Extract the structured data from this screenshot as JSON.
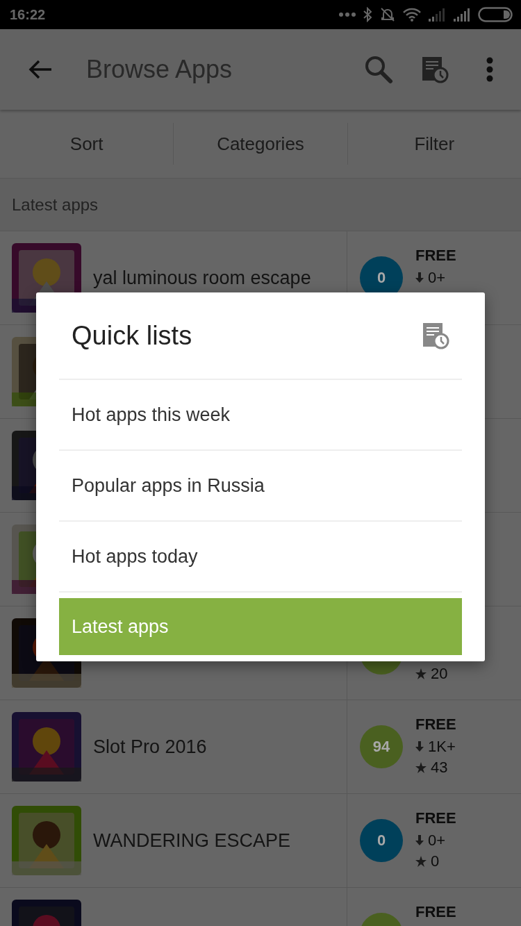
{
  "status_bar": {
    "time": "16:22"
  },
  "app_bar": {
    "title": "Browse Apps"
  },
  "tabs": [
    {
      "label": "Sort"
    },
    {
      "label": "Categories"
    },
    {
      "label": "Filter"
    }
  ],
  "section": {
    "title": "Latest apps"
  },
  "apps": [
    {
      "icon": {
        "kind": "picture"
      },
      "title": "yal luminous room escape",
      "score": "0",
      "color": "#00405a",
      "price": "FREE",
      "downloads": "0+"
    },
    {
      "icon": {
        "kind": "picture"
      }
    },
    {
      "icon": {
        "kind": "picture"
      }
    },
    {
      "icon": {
        "kind": "picture"
      }
    },
    {
      "icon": {
        "kind": "picture"
      },
      "color": "#4a6020",
      "stars": "20"
    },
    {
      "icon": {
        "kind": "picture"
      },
      "title": "Slot Pro 2016",
      "score": "94",
      "color": "#4a6020",
      "price": "FREE",
      "downloads": "1K+",
      "stars": "43"
    },
    {
      "icon": {
        "kind": "picture"
      },
      "title": "WANDERING ESCAPE",
      "score": "0",
      "color": "#00405a",
      "price": "FREE",
      "downloads": "0+",
      "stars": "0"
    },
    {
      "icon": {
        "kind": "picture"
      },
      "color": "#4a6020",
      "price": "FREE"
    }
  ],
  "dialog": {
    "title": "Quick lists",
    "items": [
      {
        "label": "Hot apps this week",
        "selected": false
      },
      {
        "label": "Popular apps in Russia",
        "selected": false
      },
      {
        "label": "Hot apps today",
        "selected": false
      },
      {
        "label": "Latest apps",
        "selected": true
      }
    ]
  }
}
